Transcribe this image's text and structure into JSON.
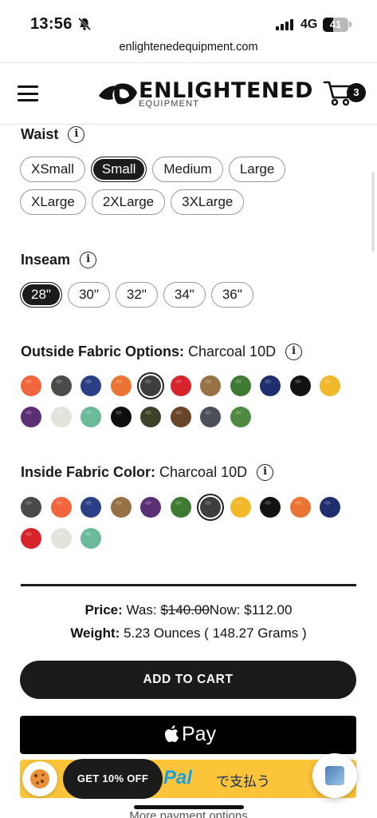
{
  "status_bar": {
    "time": "13:56",
    "network": "4G",
    "battery": "41"
  },
  "browser": {
    "url": "enlightenedequipment.com"
  },
  "header": {
    "logo_word": "ENLIGHTENED",
    "logo_sub": "EQUIPMENT",
    "cart_count": "3"
  },
  "waist": {
    "title": "Waist",
    "options": [
      "XSmall",
      "Small",
      "Medium",
      "Large",
      "XLarge",
      "2XLarge",
      "3XLarge"
    ],
    "selected": "Small"
  },
  "inseam": {
    "title": "Inseam",
    "options": [
      "28\"",
      "30\"",
      "32\"",
      "34\"",
      "36\""
    ],
    "selected": "28\""
  },
  "outside_fabric": {
    "title": "Outside Fabric Options:",
    "value": "Charcoal 10D",
    "swatches": [
      "#f2663d",
      "#4b4b4b",
      "#2b3f86",
      "#ea7433",
      "#3e3e3e",
      "#d8232a",
      "#977246",
      "#3f7a32",
      "#1f2e6e",
      "#121212",
      "#f1b92a",
      "#5b2f73",
      "#e4e2dd",
      "#6bbb9b",
      "#0f0f0f",
      "#3e4028",
      "#6a4428",
      "#4d4f58",
      "#4e8a3f"
    ],
    "selected_index": 4
  },
  "inside_fabric": {
    "title": "Inside Fabric Color:",
    "value": "Charcoal 10D",
    "swatches": [
      "#4a4a4a",
      "#f2663d",
      "#2b3f86",
      "#977246",
      "#5b2f73",
      "#3f7a32",
      "#3e3e3e",
      "#f1b92a",
      "#121212",
      "#ea7433",
      "#1f2e6e",
      "#d8232a",
      "#e4e2dd",
      "#6bbb9b"
    ],
    "selected_index": 6
  },
  "pricing": {
    "price_label": "Price:",
    "was_label": "Was:",
    "was_value": "$140.00",
    "now_label": "Now:",
    "now_value": "$112.00",
    "weight_label": "Weight:",
    "weight_value": "5.23 Ounces ( 148.27 Grams )"
  },
  "actions": {
    "add_to_cart": "ADD TO CART",
    "apple_pay": "Pay",
    "paypal_brand": "Pal",
    "paypal_text": "で支払う",
    "more_payment": "More payment options",
    "discount": "GET 10% OFF"
  }
}
